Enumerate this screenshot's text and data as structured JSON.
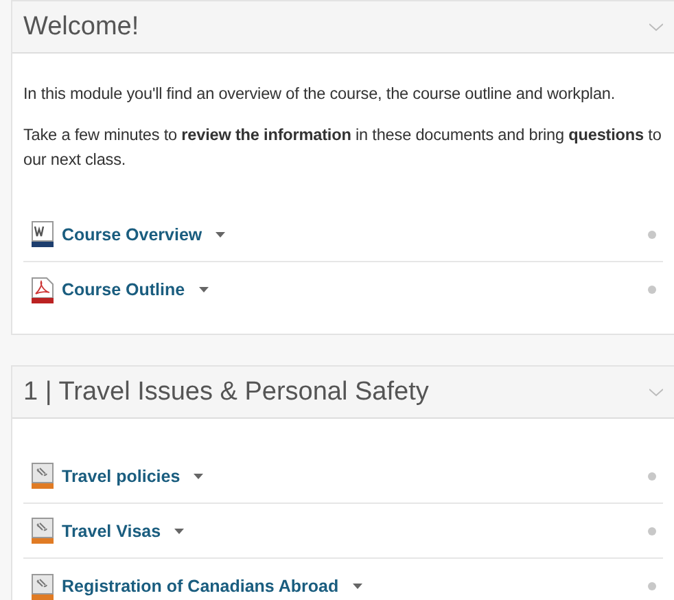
{
  "modules": [
    {
      "title": "Welcome!",
      "expanded": true,
      "description": [
        "In this module you'll find an overview of the course, the course outline and workplan.",
        "Take a few minutes to **review the information** in these documents and bring **questions** to our next class."
      ],
      "items": [
        {
          "kind": "word",
          "label": "Course Overview"
        },
        {
          "kind": "pdf",
          "label": "Course Outline"
        }
      ]
    },
    {
      "title": "1 | Travel Issues & Personal Safety",
      "expanded": true,
      "items": [
        {
          "kind": "link",
          "label": "Travel policies"
        },
        {
          "kind": "link",
          "label": "Travel Visas"
        },
        {
          "kind": "link",
          "label": "Registration of Canadians Abroad"
        }
      ]
    }
  ]
}
